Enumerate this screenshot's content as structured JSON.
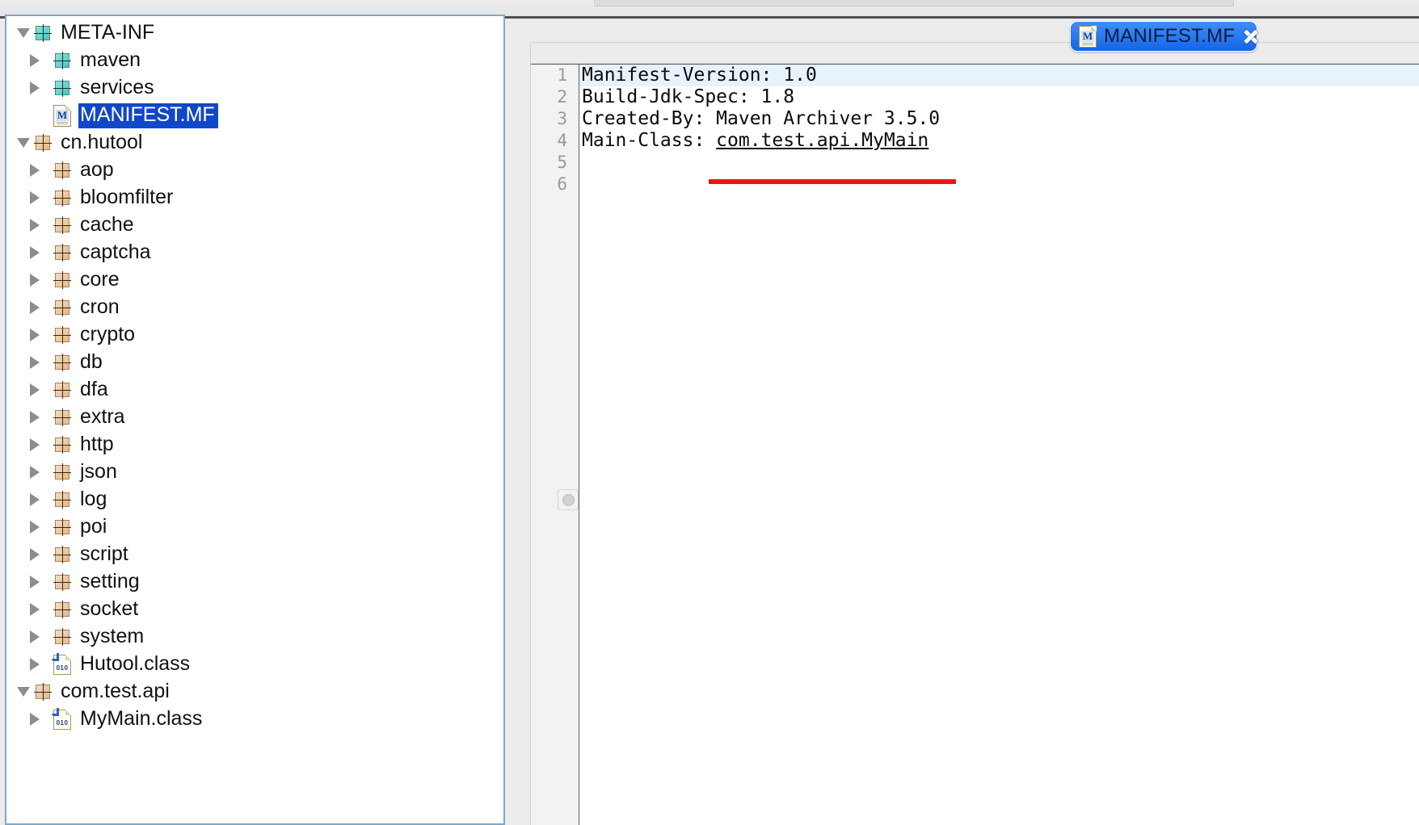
{
  "window": {
    "title": "MANIFEST.MF"
  },
  "editor_tab": {
    "label": "MANIFEST.MF",
    "icon": "manifest-file-icon",
    "close_icon": "close-icon",
    "active": true
  },
  "tree": {
    "items": [
      {
        "label": "META-INF",
        "depth": 0,
        "twisty": "down",
        "icon": "package-icon-teal"
      },
      {
        "label": "maven",
        "depth": 1,
        "twisty": "right",
        "icon": "package-icon-teal"
      },
      {
        "label": "services",
        "depth": 1,
        "twisty": "right",
        "icon": "package-icon-teal"
      },
      {
        "label": "MANIFEST.MF",
        "depth": 1,
        "twisty": "none",
        "icon": "manifest-file-icon",
        "selected": true
      },
      {
        "label": "cn.hutool",
        "depth": 0,
        "twisty": "down",
        "icon": "package-icon-tan"
      },
      {
        "label": "aop",
        "depth": 1,
        "twisty": "right",
        "icon": "package-icon-tan"
      },
      {
        "label": "bloomfilter",
        "depth": 1,
        "twisty": "right",
        "icon": "package-icon-tan"
      },
      {
        "label": "cache",
        "depth": 1,
        "twisty": "right",
        "icon": "package-icon-tan"
      },
      {
        "label": "captcha",
        "depth": 1,
        "twisty": "right",
        "icon": "package-icon-tan"
      },
      {
        "label": "core",
        "depth": 1,
        "twisty": "right",
        "icon": "package-icon-tan"
      },
      {
        "label": "cron",
        "depth": 1,
        "twisty": "right",
        "icon": "package-icon-tan"
      },
      {
        "label": "crypto",
        "depth": 1,
        "twisty": "right",
        "icon": "package-icon-tan"
      },
      {
        "label": "db",
        "depth": 1,
        "twisty": "right",
        "icon": "package-icon-tan"
      },
      {
        "label": "dfa",
        "depth": 1,
        "twisty": "right",
        "icon": "package-icon-tan"
      },
      {
        "label": "extra",
        "depth": 1,
        "twisty": "right",
        "icon": "package-icon-tan"
      },
      {
        "label": "http",
        "depth": 1,
        "twisty": "right",
        "icon": "package-icon-tan"
      },
      {
        "label": "json",
        "depth": 1,
        "twisty": "right",
        "icon": "package-icon-tan"
      },
      {
        "label": "log",
        "depth": 1,
        "twisty": "right",
        "icon": "package-icon-tan"
      },
      {
        "label": "poi",
        "depth": 1,
        "twisty": "right",
        "icon": "package-icon-tan"
      },
      {
        "label": "script",
        "depth": 1,
        "twisty": "right",
        "icon": "package-icon-tan"
      },
      {
        "label": "setting",
        "depth": 1,
        "twisty": "right",
        "icon": "package-icon-tan"
      },
      {
        "label": "socket",
        "depth": 1,
        "twisty": "right",
        "icon": "package-icon-tan"
      },
      {
        "label": "system",
        "depth": 1,
        "twisty": "right",
        "icon": "package-icon-tan"
      },
      {
        "label": "Hutool.class",
        "depth": 1,
        "twisty": "right",
        "icon": "java-class-icon"
      },
      {
        "label": "com.test.api",
        "depth": 0,
        "twisty": "down",
        "icon": "package-icon-tan"
      },
      {
        "label": "MyMain.class",
        "depth": 1,
        "twisty": "right",
        "icon": "java-class-icon"
      }
    ]
  },
  "code": {
    "gutter": [
      "1",
      "2",
      "3",
      "4",
      "5",
      "6"
    ],
    "lines": [
      {
        "n": "1",
        "text": "Manifest-Version: 1.0",
        "current": true
      },
      {
        "n": "2",
        "text": "Build-Jdk-Spec: 1.8"
      },
      {
        "n": "3",
        "text": "Created-By: Maven Archiver 3.5.0"
      },
      {
        "n": "4",
        "text": "Main-Class: ",
        "link": "com.test.api.MyMain"
      },
      {
        "n": "5",
        "text": ""
      },
      {
        "n": "6",
        "text": ""
      }
    ],
    "annotation": "red-underline"
  },
  "icons": {
    "splitter": "splitter-handle-dot"
  },
  "colors": {
    "tab_blue": "#1565e8",
    "selection_blue": "#1147c9",
    "current_line": "#e8f2fd",
    "annotation_red": "#f01414",
    "package_teal": "#46c7c0",
    "package_tan": "#e9b880",
    "panel_border": "#7fa8cc"
  }
}
